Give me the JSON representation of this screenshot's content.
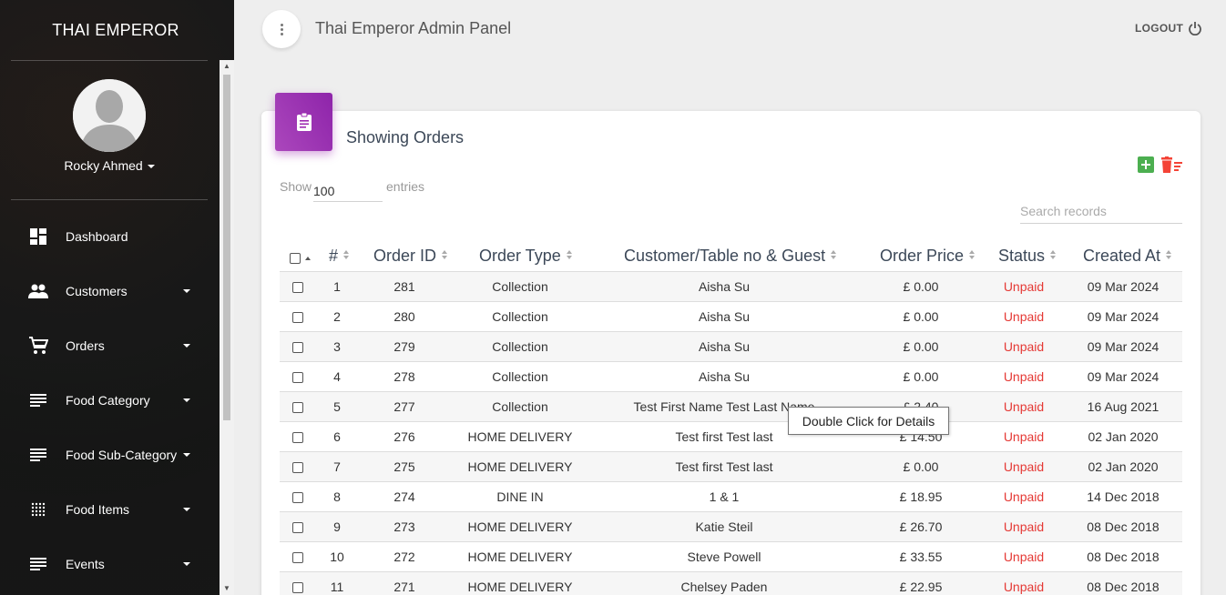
{
  "sidebar": {
    "brand": "THAI EMPEROR",
    "user_name": "Rocky Ahmed",
    "items": [
      {
        "label": "Dashboard",
        "icon": "dashboard-icon",
        "has_caret": false
      },
      {
        "label": "Customers",
        "icon": "people-icon",
        "has_caret": true
      },
      {
        "label": "Orders",
        "icon": "cart-icon",
        "has_caret": true
      },
      {
        "label": "Food Category",
        "icon": "list-icon",
        "has_caret": true
      },
      {
        "label": "Food Sub-Category",
        "icon": "list-icon",
        "has_caret": true
      },
      {
        "label": "Food Items",
        "icon": "grid-dots-icon",
        "has_caret": true
      },
      {
        "label": "Events",
        "icon": "list-icon",
        "has_caret": true
      }
    ]
  },
  "header": {
    "title": "Thai Emperor Admin Panel",
    "logout_label": "LOGOUT"
  },
  "card": {
    "title": "Showing Orders",
    "show_label": "Show",
    "entries_value": "100",
    "entries_label": "entries",
    "search_placeholder": "Search records"
  },
  "table": {
    "columns": [
      "#",
      "Order ID",
      "Order Type",
      "Customer/Table no & Guest",
      "Order Price",
      "Status",
      "Created At"
    ],
    "rows": [
      {
        "n": "1",
        "id": "281",
        "type": "Collection",
        "customer": "Aisha Su",
        "price": "£ 0.00",
        "status": "Unpaid",
        "created": "09 Mar 2024"
      },
      {
        "n": "2",
        "id": "280",
        "type": "Collection",
        "customer": "Aisha Su",
        "price": "£ 0.00",
        "status": "Unpaid",
        "created": "09 Mar 2024"
      },
      {
        "n": "3",
        "id": "279",
        "type": "Collection",
        "customer": "Aisha Su",
        "price": "£ 0.00",
        "status": "Unpaid",
        "created": "09 Mar 2024"
      },
      {
        "n": "4",
        "id": "278",
        "type": "Collection",
        "customer": "Aisha Su",
        "price": "£ 0.00",
        "status": "Unpaid",
        "created": "09 Mar 2024"
      },
      {
        "n": "5",
        "id": "277",
        "type": "Collection",
        "customer": "Test First Name Test Last Name",
        "price": "£ 2.40",
        "status": "Unpaid",
        "created": "16 Aug 2021"
      },
      {
        "n": "6",
        "id": "276",
        "type": "HOME DELIVERY",
        "customer": "Test first Test last",
        "price": "£ 14.50",
        "status": "Unpaid",
        "created": "02 Jan 2020"
      },
      {
        "n": "7",
        "id": "275",
        "type": "HOME DELIVERY",
        "customer": "Test first Test last",
        "price": "£ 0.00",
        "status": "Unpaid",
        "created": "02 Jan 2020"
      },
      {
        "n": "8",
        "id": "274",
        "type": "DINE IN",
        "customer": "1 & 1",
        "price": "£ 18.95",
        "status": "Unpaid",
        "created": "14 Dec 2018"
      },
      {
        "n": "9",
        "id": "273",
        "type": "HOME DELIVERY",
        "customer": "Katie Steil",
        "price": "£ 26.70",
        "status": "Unpaid",
        "created": "08 Dec 2018"
      },
      {
        "n": "10",
        "id": "272",
        "type": "HOME DELIVERY",
        "customer": "Steve Powell",
        "price": "£ 33.55",
        "status": "Unpaid",
        "created": "08 Dec 2018"
      },
      {
        "n": "11",
        "id": "271",
        "type": "HOME DELIVERY",
        "customer": "Chelsey Paden",
        "price": "£ 22.95",
        "status": "Unpaid",
        "created": "08 Dec 2018"
      }
    ]
  },
  "tooltip": "Double Click for Details",
  "colors": {
    "accent_purple": "#9c27b0",
    "add_green": "#4caf50",
    "delete_red": "#f44336",
    "unpaid_red": "#e53935"
  }
}
